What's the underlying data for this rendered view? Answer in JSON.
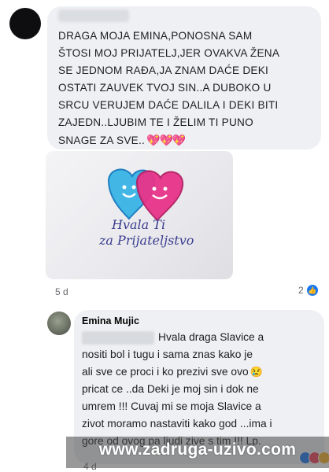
{
  "comment_1": {
    "lines": [
      "DRAGA MOJA EMINA,PONOSNA SAM",
      "ŠTOSI MOJ PRIJATELJ,JER OVAKVA ŽENA",
      "SE JEDNOM RAĐA,JA ZNAM DAĆE DEKI",
      "OSTATI ZAUVEK TVOJ SIN..A DUBOKO U",
      "SRCU VERUJEM DAĆE DALILA I DEKI BITI",
      "ZAJEDN..LJUBIM TE I ŽELIM TI PUNO",
      "SNAGE ZA SVE.."
    ],
    "hearts": "💖💖💖",
    "image": {
      "caption_line_1": "Hvala Ti",
      "caption_line_2": "za Prijateljstvo",
      "colors": {
        "left_heart": "#3fb8e8",
        "right_heart": "#e42f86"
      }
    },
    "time": "5 d",
    "reaction_count": "2",
    "reaction_icon": "like-icon"
  },
  "comment_2": {
    "author": "Emina Mujic",
    "lines": [
      "Hvala draga Slavice a",
      "nositi bol i tugu i sama znas kako je",
      "ali sve ce proci i ko prezivi sve ovo",
      "pricat ce ..da Deki je moj sin i dok ne",
      "umrem !!! Cuvaj mi se moja Slavice a",
      "zivot moramo nastaviti kako god ...ima i",
      "gore od ovog pa ljudi zive s tim !!! Lp."
    ],
    "cry_emoji": "😢",
    "time": "4 d",
    "reaction_icons": [
      "like-icon",
      "heart-icon",
      "sad-icon"
    ]
  },
  "watermark": "www.zadruga-uzivo.com",
  "colors": {
    "bubble": "#eef0f3",
    "like_blue": "#1877f2",
    "meta_text": "#65676b"
  }
}
